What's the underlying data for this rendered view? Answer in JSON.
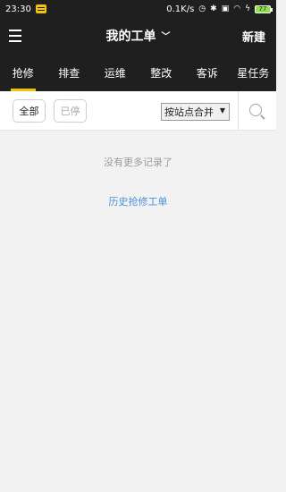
{
  "status_bar": {
    "time": "23:30",
    "network_speed": "0.1K/s",
    "battery": "77"
  },
  "header": {
    "title": "我的工单",
    "new_label": "新建"
  },
  "tabs": [
    {
      "label": "抢修",
      "active": true
    },
    {
      "label": "排查",
      "active": false
    },
    {
      "label": "运维",
      "active": false
    },
    {
      "label": "整改",
      "active": false
    },
    {
      "label": "客诉",
      "active": false
    },
    {
      "label": "星任务",
      "active": false
    }
  ],
  "filters": {
    "all_label": "全部",
    "stopped_label": "已停",
    "merge_select": "按站点合并"
  },
  "content": {
    "empty_message": "没有更多记录了",
    "history_link": "历史抢修工单"
  },
  "colors": {
    "dark_bar": "#1f1f1f",
    "accent_underline": "#f5c400",
    "link": "#4a90d9"
  }
}
